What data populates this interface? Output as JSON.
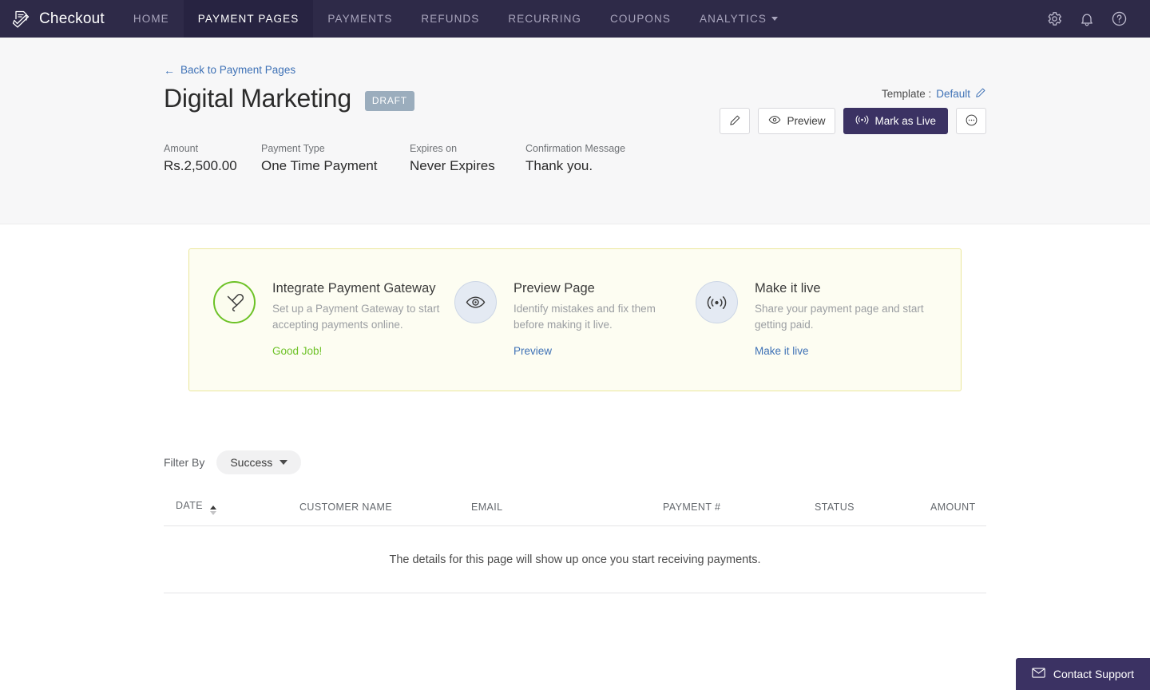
{
  "navbar": {
    "brand": "Checkout",
    "logo_icon": "checkout-document-check-icon",
    "links": [
      {
        "label": "HOME",
        "active": false
      },
      {
        "label": "PAYMENT PAGES",
        "active": true
      },
      {
        "label": "PAYMENTS",
        "active": false
      },
      {
        "label": "REFUNDS",
        "active": false
      },
      {
        "label": "RECURRING",
        "active": false
      },
      {
        "label": "COUPONS",
        "active": false
      },
      {
        "label": "ANALYTICS",
        "active": false,
        "has_caret": true
      }
    ],
    "icons": [
      "gear-icon",
      "bell-icon",
      "help-icon"
    ],
    "background": "#2e2a48",
    "active_background": "#272341"
  },
  "header": {
    "back_link": "Back to Payment Pages",
    "back_arrow": "←",
    "title": "Digital Marketing",
    "status_badge": "DRAFT",
    "badge_color": "#9badbd",
    "actions": {
      "edit_label": "",
      "preview_label": "Preview",
      "mark_live_label": "Mark as Live",
      "more_label": "",
      "primary_color": "#3b3263"
    }
  },
  "meta": [
    {
      "label": "Amount",
      "value": "Rs.2,500.00"
    },
    {
      "label": "Payment Type",
      "value": "One Time Payment"
    },
    {
      "label": "Expires on",
      "value": "Never Expires"
    },
    {
      "label": "Confirmation Message",
      "value": "Thank you."
    }
  ],
  "template": {
    "label": "Template :",
    "value": "Default",
    "edit_icon": "pencil-icon"
  },
  "steps_card": {
    "border_color": "#ebe79b",
    "background": "#fdfdf2",
    "steps": [
      {
        "icon": "plug-icon",
        "icon_style": "green",
        "title": "Integrate Payment Gateway",
        "description": "Set up a Payment Gateway to start accepting payments online.",
        "action": "Good Job!",
        "action_style": "green"
      },
      {
        "icon": "eye-icon",
        "icon_style": "blue",
        "title": "Preview Page",
        "description": "Identify mistakes and fix them before making it live.",
        "action": "Preview",
        "action_style": "link"
      },
      {
        "icon": "broadcast-icon",
        "icon_style": "blue",
        "title": "Make it live",
        "description": "Share your payment page and start getting paid.",
        "action": "Make it live",
        "action_style": "link"
      }
    ]
  },
  "filter": {
    "label": "Filter By",
    "selected": "Success"
  },
  "table": {
    "columns": [
      "DATE",
      "CUSTOMER NAME",
      "EMAIL",
      "PAYMENT #",
      "STATUS",
      "AMOUNT"
    ],
    "sorted_column": "DATE",
    "sort_direction": "asc",
    "rows": [],
    "empty_message": "The details for this page will show up once you start receiving payments."
  },
  "support": {
    "label": "Contact Support",
    "icon": "mail-icon",
    "background": "#3b3263"
  }
}
